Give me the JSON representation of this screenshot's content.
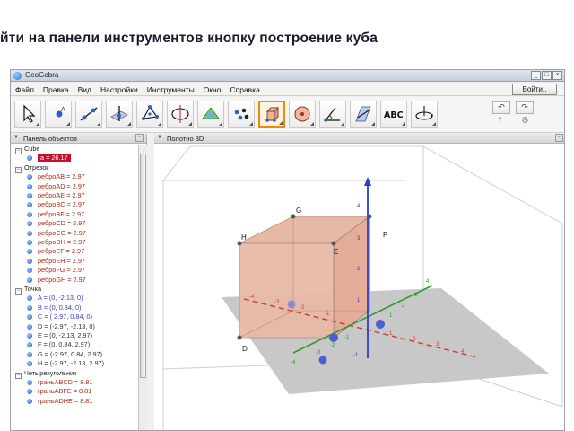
{
  "slide": {
    "title": "йти на панели инструментов кнопку  построение куба"
  },
  "window": {
    "title": "GeoGebra",
    "buttons": [
      "_",
      "□",
      "×"
    ]
  },
  "menu": {
    "items": [
      "Файл",
      "Правка",
      "Вид",
      "Настройки",
      "Инструменты",
      "Окно",
      "Справка"
    ],
    "login": "Войти.."
  },
  "toolbar": {
    "tools": [
      "move-tool",
      "point-tool",
      "line-tool",
      "perpendicular-tool",
      "polygon-tool",
      "circle-tool",
      "intersect-tool",
      "sphere-tool",
      "cube-tool",
      "circle-axis-tool",
      "angle-tool",
      "reflect-tool",
      "text-tool",
      "rotate-view-tool"
    ],
    "selected": "cube-tool",
    "text_tool_label": "ABC",
    "undo": "↶",
    "redo": "↷",
    "help": "?",
    "settings": "⚙"
  },
  "algebra_panel": {
    "header": "Панель объектов",
    "rows": [
      {
        "kind": "cat",
        "text": "Cube"
      },
      {
        "kind": "item",
        "text": "a = 26.17",
        "style": "hl"
      },
      {
        "kind": "cat",
        "text": "Отрезок"
      },
      {
        "kind": "item",
        "text": "реброAB = 2.97",
        "style": "red"
      },
      {
        "kind": "item",
        "text": "реброAD = 2.97",
        "style": "red"
      },
      {
        "kind": "item",
        "text": "реброAE = 2.97",
        "style": "red"
      },
      {
        "kind": "item",
        "text": "реброBC = 2.97",
        "style": "red"
      },
      {
        "kind": "item",
        "text": "реброBF = 2.97",
        "style": "red"
      },
      {
        "kind": "item",
        "text": "реброCD = 2.97",
        "style": "red"
      },
      {
        "kind": "item",
        "text": "реброCG = 2.97",
        "style": "red"
      },
      {
        "kind": "item",
        "text": "реброDH = 2.97",
        "style": "red"
      },
      {
        "kind": "item",
        "text": "реброEF = 2.97",
        "style": "red"
      },
      {
        "kind": "item",
        "text": "реброEH = 2.97",
        "style": "red"
      },
      {
        "kind": "item",
        "text": "реброFG = 2.97",
        "style": "red"
      },
      {
        "kind": "item",
        "text": "реброGH = 2.97",
        "style": "red"
      },
      {
        "kind": "cat",
        "text": "Точка"
      },
      {
        "kind": "item",
        "text": "A = (0, -2.13, 0)",
        "style": "blue"
      },
      {
        "kind": "item",
        "text": "B = (0, 0.84, 0)",
        "style": "blue"
      },
      {
        "kind": "item",
        "text": "C = ( 2.97, 0.84, 0)",
        "style": "blue"
      },
      {
        "kind": "item",
        "text": "D = (-2.97, -2.13, 0)",
        "style": "dark"
      },
      {
        "kind": "item",
        "text": "E = (0, -2.13, 2.97)",
        "style": "dark"
      },
      {
        "kind": "item",
        "text": "F = (0, 0.84, 2.97)",
        "style": "dark"
      },
      {
        "kind": "item",
        "text": "G = (-2.97, 0.84, 2.97)",
        "style": "dark"
      },
      {
        "kind": "item",
        "text": "H = (-2.97, -2.13, 2.97)",
        "style": "dark"
      },
      {
        "kind": "cat",
        "text": "Четырехугольник"
      },
      {
        "kind": "item",
        "text": "граньABCD = 8.81",
        "style": "red"
      },
      {
        "kind": "item",
        "text": "граньABFE = 8.81",
        "style": "red"
      },
      {
        "kind": "item",
        "text": "граньADHE = 8.81",
        "style": "red"
      }
    ]
  },
  "graphics_panel": {
    "header": "Полотно 3D",
    "point_labels": [
      "G",
      "F",
      "H",
      "E",
      "D"
    ],
    "axis_ticks": {
      "z": [
        "4",
        "3",
        "2",
        "1",
        "-1"
      ],
      "y": [
        "4",
        "3",
        "2",
        "1",
        "-1",
        "-2",
        "-3",
        "-4"
      ],
      "x": [
        "1",
        "2",
        "3",
        "4",
        "-1",
        "-2",
        "-3",
        "-4"
      ]
    }
  }
}
